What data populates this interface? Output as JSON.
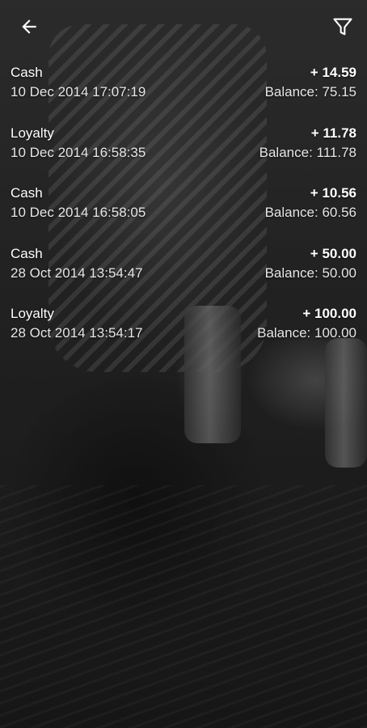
{
  "toolbar": {
    "back_icon": "arrow-left-icon",
    "filter_icon": "filter-icon"
  },
  "transactions": [
    {
      "type": "Cash",
      "datetime": "10 Dec 2014 17:07:19",
      "amount": "+ 14.59",
      "balance": "Balance: 75.15"
    },
    {
      "type": "Loyalty",
      "datetime": "10 Dec 2014 16:58:35",
      "amount": "+ 11.78",
      "balance": "Balance: 111.78"
    },
    {
      "type": "Cash",
      "datetime": "10 Dec 2014 16:58:05",
      "amount": "+ 10.56",
      "balance": "Balance: 60.56"
    },
    {
      "type": "Cash",
      "datetime": "28 Oct 2014 13:54:47",
      "amount": "+ 50.00",
      "balance": "Balance: 50.00"
    },
    {
      "type": "Loyalty",
      "datetime": "28 Oct 2014 13:54:17",
      "amount": "+ 100.00",
      "balance": "Balance: 100.00"
    }
  ],
  "colors": {
    "text": "#ffffff",
    "overlay": "#000000"
  }
}
